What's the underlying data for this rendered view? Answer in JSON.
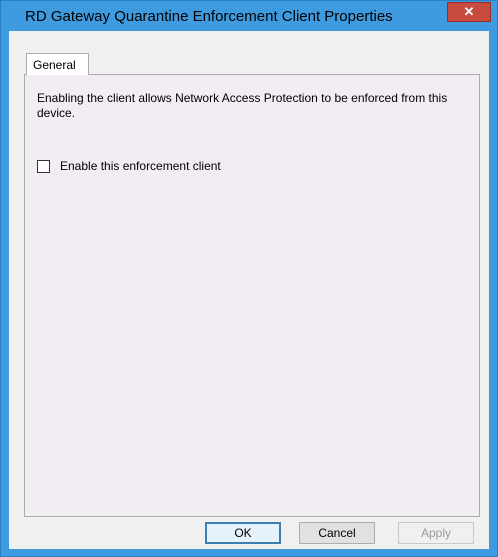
{
  "window": {
    "title": "RD Gateway Quarantine Enforcement Client Properties",
    "close_glyph": "✕"
  },
  "tabs": [
    {
      "label": "General"
    }
  ],
  "general": {
    "description": "Enabling the client allows Network Access Protection to be enforced from this device.",
    "enable_checkbox": {
      "label": "Enable this enforcement client",
      "checked": false
    }
  },
  "buttons": {
    "ok": "OK",
    "cancel": "Cancel",
    "apply": "Apply"
  },
  "colors": {
    "frame": "#3f9be0",
    "close": "#c74b3f",
    "panel": "#f2edf2"
  }
}
